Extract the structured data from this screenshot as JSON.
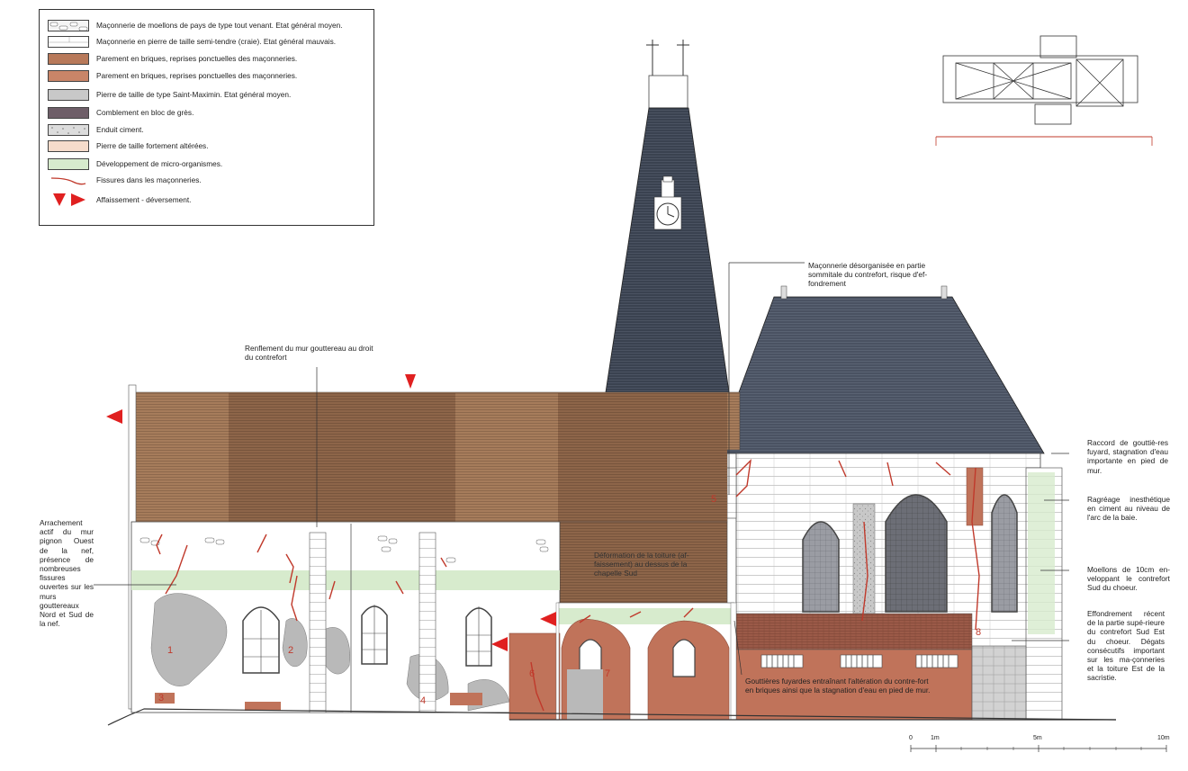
{
  "legend": {
    "items": [
      {
        "label": "Maçonnerie de moellons de pays de type tout venant. Etat général moyen.",
        "swatch": "rubble",
        "color": "#f4f4f4"
      },
      {
        "label": "Maçonnerie en pierre de taille semi-tendre (craie). Etat général mauvais.",
        "swatch": "ashlar",
        "color": "#ffffff"
      },
      {
        "label": "Parement en briques, reprises ponctuelles des maçonneries.",
        "swatch": "brick",
        "color": "#b8795a"
      },
      {
        "label": "Parement en briques, reprises ponctuelles des maçonneries.",
        "swatch": "brick2",
        "color": "#c98568"
      },
      {
        "label": "Pierre de taille de type Saint-Maximin. Etat général moyen.",
        "swatch": "stone",
        "color": "#c8c8c8"
      },
      {
        "label": "Comblement en bloc de grès.",
        "swatch": "sandstone",
        "color": "#6e5e68"
      },
      {
        "label": "Enduit ciment.",
        "swatch": "cement",
        "color": "#dcdcdc"
      },
      {
        "label": "Pierre de taille fortement altérées.",
        "swatch": "altered",
        "color": "#f6dccb"
      },
      {
        "label": "Développement de micro-organismes.",
        "swatch": "micro",
        "color": "#d7ebcd"
      },
      {
        "label": "Fissures dans les maçonneries.",
        "swatch": "crack",
        "color": "#c0392b"
      },
      {
        "label": "Affaissement - déversement.",
        "swatch": "arrow",
        "color": "#e02020"
      }
    ]
  },
  "annotations": {
    "renflement": "Renflement du mur gouttereau au droit du contrefort",
    "maconnerie_desorg": "Maçonnerie désorganisée en partie sommitale du contrefort, risque d'ef-fondrement",
    "arrachement": "Arrachement actif du mur pignon Ouest de la nef, présence de nombreuses fissures ouvertes sur les murs gouttereaux Nord et Sud de la nef.",
    "deformation": "Déformation de la toiture (af-faissement) au dessus de la chapelle Sud",
    "gouttieres": "Gouttières fuyardes entraînant l'altération du contre-fort en briques ainsi que la stagnation d'eau en pied de mur.",
    "raccord": "Raccord de gouttiè-res fuyard, stagnation d'eau importante en pied de mur.",
    "ragreage": "Ragréage inesthétique en ciment au niveau de l'arc de la baie.",
    "moellons": "Moellons de 10cm en-veloppant le contrefort Sud du choeur.",
    "effondrement": "Effondrement récent de la partie supé-rieure du contrefort Sud Est du choeur. Dégats consécutifs important sur les ma-çonneries et la toiture Est de la sacristie."
  },
  "markers": [
    "1",
    "2",
    "3",
    "4",
    "5",
    "6",
    "7",
    "8"
  ],
  "scale": {
    "labels": [
      "0",
      "1m",
      "5m",
      "10m"
    ],
    "values_m": [
      0,
      1,
      5,
      10
    ]
  },
  "colors": {
    "slate": "#3a4250",
    "roof_brick_light": "#a67c5b",
    "roof_brick_dark": "#8d6549",
    "brick_red": "#c0735a",
    "crack": "#c0392b",
    "arrow": "#e02020",
    "micro": "#d7ebcd",
    "grey_stone": "#b9b9b9"
  }
}
